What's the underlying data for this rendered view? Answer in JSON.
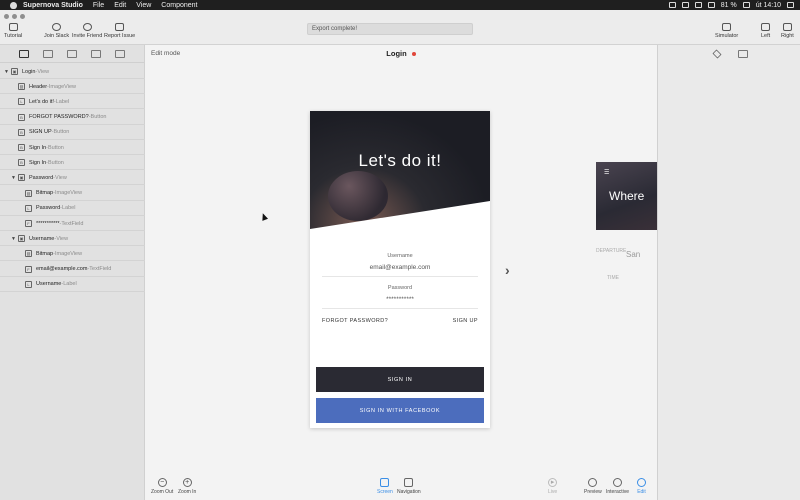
{
  "menubar": {
    "app_name": "Supernova Studio",
    "items": [
      "File",
      "Edit",
      "View",
      "Component"
    ],
    "battery": "81 %",
    "clock": "út 14:10"
  },
  "toolbar": {
    "tutorial": "Tutorial",
    "join_slack": "Join Slack",
    "invite_friend": "Invite Friend",
    "report_issue": "Report Issue",
    "status_text": "Export complete!",
    "simulator": "Simulator",
    "left": "Left",
    "right": "Right"
  },
  "layers": [
    {
      "name": "Login",
      "type": "View",
      "depth": 0,
      "disclosure": "▼",
      "icon": "▣"
    },
    {
      "name": "Header",
      "type": "ImageView",
      "depth": 1,
      "disclosure": "",
      "icon": "▨"
    },
    {
      "name": "Let's do it!",
      "type": "Label",
      "depth": 1,
      "disclosure": "",
      "icon": "L"
    },
    {
      "name": "FORGOT PASSWORD?",
      "type": "Button",
      "depth": 1,
      "disclosure": "",
      "icon": "B"
    },
    {
      "name": "SIGN UP",
      "type": "Button",
      "depth": 1,
      "disclosure": "",
      "icon": "B"
    },
    {
      "name": "Sign In",
      "type": "Button",
      "depth": 1,
      "disclosure": "",
      "icon": "B"
    },
    {
      "name": "Sign In",
      "type": "Button",
      "depth": 1,
      "disclosure": "",
      "icon": "B"
    },
    {
      "name": "Password",
      "type": "View",
      "depth": 1,
      "disclosure": "▼",
      "icon": "▣"
    },
    {
      "name": "Bitmap",
      "type": "ImageView",
      "depth": 2,
      "disclosure": "",
      "icon": "▨"
    },
    {
      "name": "Password",
      "type": "Label",
      "depth": 2,
      "disclosure": "",
      "icon": "L"
    },
    {
      "name": "***********",
      "type": "TextField",
      "depth": 2,
      "disclosure": "",
      "icon": "F"
    },
    {
      "name": "Username",
      "type": "View",
      "depth": 1,
      "disclosure": "▼",
      "icon": "▣"
    },
    {
      "name": "Bitmap",
      "type": "ImageView",
      "depth": 2,
      "disclosure": "",
      "icon": "▨"
    },
    {
      "name": "email@example.com",
      "type": "TextField",
      "depth": 2,
      "disclosure": "",
      "icon": "F"
    },
    {
      "name": "Username",
      "type": "Label",
      "depth": 2,
      "disclosure": "",
      "icon": "L"
    }
  ],
  "canvas": {
    "mode": "Edit mode",
    "screen_title": "Login"
  },
  "mockup": {
    "hero_title": "Let's do it!",
    "username_label": "Username",
    "username_value": "email@example.com",
    "password_label": "Password",
    "password_value": "***********",
    "forgot_password": "FORGOT PASSWORD?",
    "sign_up": "SIGN UP",
    "sign_in": "SIGN IN",
    "sign_in_facebook": "SIGN IN WITH FACEBOOK"
  },
  "next_screen": {
    "title": "Where",
    "label_a": "DEPARTURE",
    "label_b": "San",
    "label_c": "TIME"
  },
  "bottom_bar": {
    "zoom_out": "Zoom Out",
    "zoom_in": "Zoom In",
    "screen": "Screen",
    "navigation": "Navigation",
    "live": "Live",
    "preview": "Preview",
    "interactive": "Interactive",
    "edit": "Edit"
  },
  "colors": {
    "accent": "#3a8ee6",
    "sign_in_button": "#2a2a33",
    "facebook_button": "#4c6dbd",
    "unsaved_dot": "#e0463a"
  }
}
